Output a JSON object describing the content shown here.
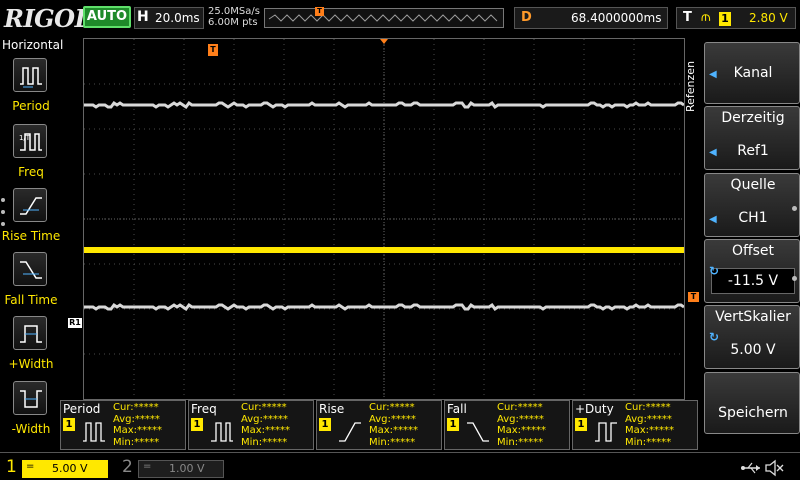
{
  "header": {
    "brand": "RIGOL",
    "run_state": "AUTO",
    "horizontal_letter": "H",
    "timebase": "20.0ms",
    "sample_rate": "25.0MSa/s",
    "memory_depth": "6.00M pts",
    "trigger_position_marker": "T",
    "delay_letter": "D",
    "delay_value": "68.4000000ms",
    "trigger_letter": "T",
    "trigger_source": "1",
    "trigger_level": "2.80 V"
  },
  "left_menu": {
    "title": "Horizontal",
    "items": [
      {
        "label": "Period",
        "icon": "period-icon"
      },
      {
        "label": "Freq",
        "icon": "frequency-icon"
      },
      {
        "label": "Rise Time",
        "icon": "rise-time-icon"
      },
      {
        "label": "Fall Time",
        "icon": "fall-time-icon"
      },
      {
        "label": "+Width",
        "icon": "positive-width-icon"
      },
      {
        "label": "-Width",
        "icon": "negative-width-icon"
      }
    ]
  },
  "grid": {
    "trigger_marker": "T",
    "trigger_level_marker": "T",
    "ref_label": "R1",
    "colors": {
      "ch1": "#ffe800",
      "ref": "#d8d8d8",
      "grid": "#4a4a4a",
      "trigger": "#ff7f1a"
    }
  },
  "right_menu": {
    "side_label": "Refenzen",
    "channel": {
      "value": "Kanal"
    },
    "current": {
      "caption": "Derzeitig",
      "value": "Ref1"
    },
    "source": {
      "caption": "Quelle",
      "value": "CH1"
    },
    "offset": {
      "caption": "Offset",
      "value": "-11.5 V"
    },
    "vscale": {
      "caption": "VertSkalier",
      "value": "5.00 V"
    },
    "save": {
      "caption": "Speichern"
    }
  },
  "measurements": [
    {
      "name": "Period",
      "chip": "1",
      "cur": "Cur:*****",
      "avg": "Avg:*****",
      "max": "Max:*****",
      "min": "Min:*****"
    },
    {
      "name": "Freq",
      "chip": "1",
      "cur": "Cur:*****",
      "avg": "Avg:*****",
      "max": "Max:*****",
      "min": "Min:*****"
    },
    {
      "name": "Rise",
      "chip": "1",
      "cur": "Cur:*****",
      "avg": "Avg:*****",
      "max": "Max:*****",
      "min": "Min:*****"
    },
    {
      "name": "Fall",
      "chip": "1",
      "cur": "Cur:*****",
      "avg": "Avg:*****",
      "max": "Max:*****",
      "min": "Min:*****"
    },
    {
      "name": "+Duty",
      "chip": "1",
      "cur": "Cur:*****",
      "avg": "Avg:*****",
      "max": "Max:*****",
      "min": "Min:*****"
    }
  ],
  "status": {
    "ch1_number": "1",
    "ch1_coupling": "=",
    "ch1_scale": "5.00 V",
    "ch2_number": "2",
    "ch2_coupling": "=",
    "ch2_scale": "1.00 V"
  }
}
